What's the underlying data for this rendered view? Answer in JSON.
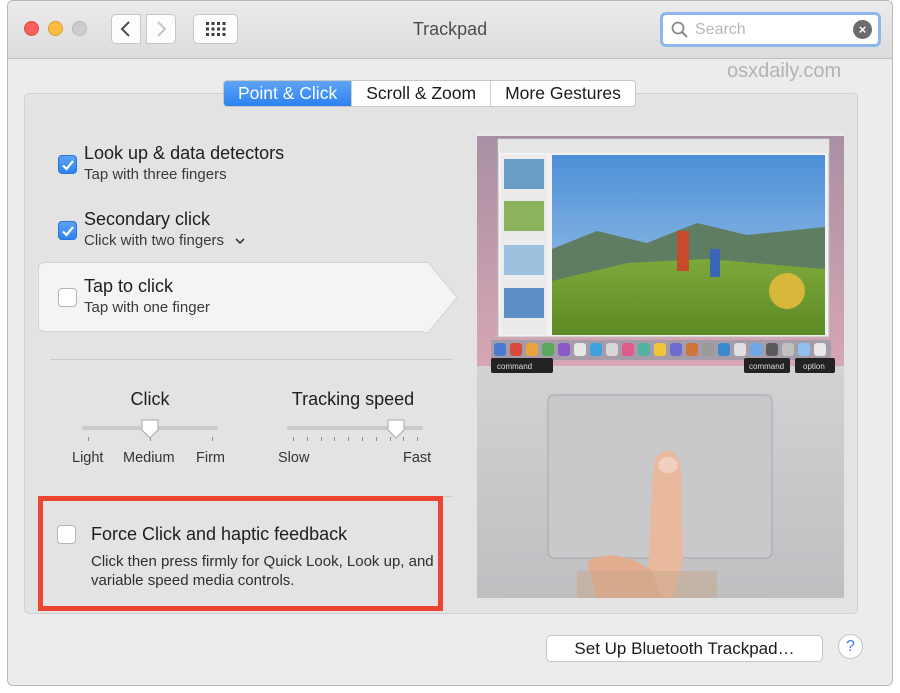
{
  "window": {
    "title": "Trackpad",
    "search_placeholder": "Search",
    "watermark": "osxdaily.com"
  },
  "tabs": [
    {
      "label": "Point & Click",
      "active": true
    },
    {
      "label": "Scroll & Zoom",
      "active": false
    },
    {
      "label": "More Gestures",
      "active": false
    }
  ],
  "options": [
    {
      "title": "Look up & data detectors",
      "subtitle": "Tap with three fingers",
      "checked": true
    },
    {
      "title": "Secondary click",
      "subtitle": "Click with two fingers",
      "checked": true
    },
    {
      "title": "Tap to click",
      "subtitle": "Tap with one finger",
      "checked": false
    }
  ],
  "sliders": {
    "click": {
      "label": "Click",
      "min_label": "Light",
      "mid_label": "Medium",
      "max_label": "Firm",
      "value_fraction": 0.5
    },
    "tracking": {
      "label": "Tracking speed",
      "min_label": "Slow",
      "max_label": "Fast",
      "value_fraction": 0.8
    }
  },
  "force_click": {
    "title": "Force Click and haptic feedback",
    "description": "Click then press firmly for Quick Look, Look up, and variable speed media controls.",
    "checked": false,
    "highlight_color": "#ee4533"
  },
  "preview": {
    "key_command_left": "command",
    "key_command_right": "command",
    "key_option": "option"
  },
  "buttons": {
    "setup": "Set Up Bluetooth Trackpad…",
    "help": "?"
  },
  "colors": {
    "accent": "#2e82ee",
    "window_bg": "#ececec"
  }
}
